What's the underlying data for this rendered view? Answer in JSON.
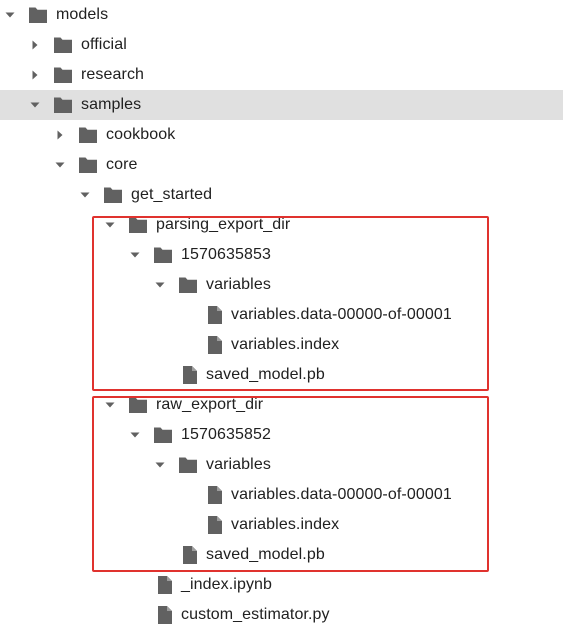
{
  "file_tree": {
    "items": [
      {
        "name": "models",
        "type": "folder",
        "state": "expanded",
        "depth": 0
      },
      {
        "name": "official",
        "type": "folder",
        "state": "collapsed",
        "depth": 1
      },
      {
        "name": "research",
        "type": "folder",
        "state": "collapsed",
        "depth": 1
      },
      {
        "name": "samples",
        "type": "folder",
        "state": "expanded",
        "depth": 1,
        "selected": true
      },
      {
        "name": "cookbook",
        "type": "folder",
        "state": "collapsed",
        "depth": 2
      },
      {
        "name": "core",
        "type": "folder",
        "state": "expanded",
        "depth": 2
      },
      {
        "name": "get_started",
        "type": "folder",
        "state": "expanded",
        "depth": 3
      },
      {
        "name": "parsing_export_dir",
        "type": "folder",
        "state": "expanded",
        "depth": 4
      },
      {
        "name": "1570635853",
        "type": "folder",
        "state": "expanded",
        "depth": 5
      },
      {
        "name": "variables",
        "type": "folder",
        "state": "expanded",
        "depth": 6
      },
      {
        "name": "variables.data-00000-of-00001",
        "type": "file",
        "depth": 7
      },
      {
        "name": "variables.index",
        "type": "file",
        "depth": 7
      },
      {
        "name": "saved_model.pb",
        "type": "file",
        "depth": 6
      },
      {
        "name": "raw_export_dir",
        "type": "folder",
        "state": "expanded",
        "depth": 4
      },
      {
        "name": "1570635852",
        "type": "folder",
        "state": "expanded",
        "depth": 5
      },
      {
        "name": "variables",
        "type": "folder",
        "state": "expanded",
        "depth": 6
      },
      {
        "name": "variables.data-00000-of-00001",
        "type": "file",
        "depth": 7
      },
      {
        "name": "variables.index",
        "type": "file",
        "depth": 7
      },
      {
        "name": "saved_model.pb",
        "type": "file",
        "depth": 6
      },
      {
        "name": "_index.ipynb",
        "type": "file",
        "depth": 5
      },
      {
        "name": "custom_estimator.py",
        "type": "file",
        "depth": 5
      }
    ]
  },
  "highlight_boxes": [
    {
      "label": "parsing_export_dir",
      "color": "#e0322e"
    },
    {
      "label": "raw_export_dir",
      "color": "#e0322e"
    }
  ],
  "colors": {
    "icon": "#616161",
    "text": "#212121",
    "selected_row": "#e0e0e0",
    "highlight": "#e0322e"
  },
  "icons": {
    "folder": "folder-icon",
    "file": "file-icon",
    "expanded": "caret-down-icon",
    "collapsed": "caret-right-icon"
  }
}
